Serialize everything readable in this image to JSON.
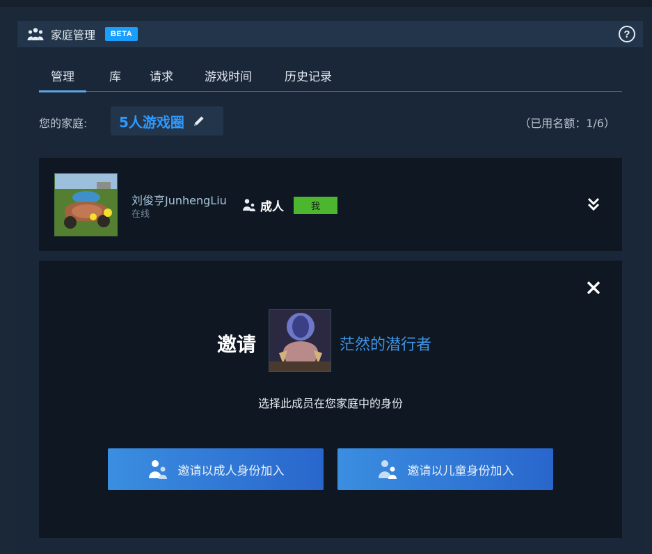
{
  "header": {
    "title": "家庭管理",
    "badge": "BETA",
    "icons": {
      "family": "family-group-icon",
      "help": "help-icon"
    },
    "help_glyph": "?"
  },
  "tabs": [
    {
      "label": "管理",
      "active": true
    },
    {
      "label": "库",
      "active": false
    },
    {
      "label": "请求",
      "active": false
    },
    {
      "label": "游戏时间",
      "active": false
    },
    {
      "label": "历史记录",
      "active": false
    }
  ],
  "family": {
    "label": "您的家庭:",
    "name": "5人游戏圈",
    "quota": "（已用名额：1/6）"
  },
  "member": {
    "name": "刘俊亨JunhengLiu",
    "status": "在线",
    "role": "成人",
    "me_badge": "我"
  },
  "invite": {
    "title": "邀请",
    "invitee_name": "茫然的潜行者",
    "subtitle": "选择此成员在您家庭中的身份",
    "adult_button": "邀请以成人身份加入",
    "child_button": "邀请以儿童身份加入"
  },
  "colors": {
    "accent": "#1a9fff",
    "family_name": "#2e9aff",
    "me_badge": "#4cb62f",
    "button_start": "#3a8ee0",
    "button_end": "#2966cc"
  }
}
